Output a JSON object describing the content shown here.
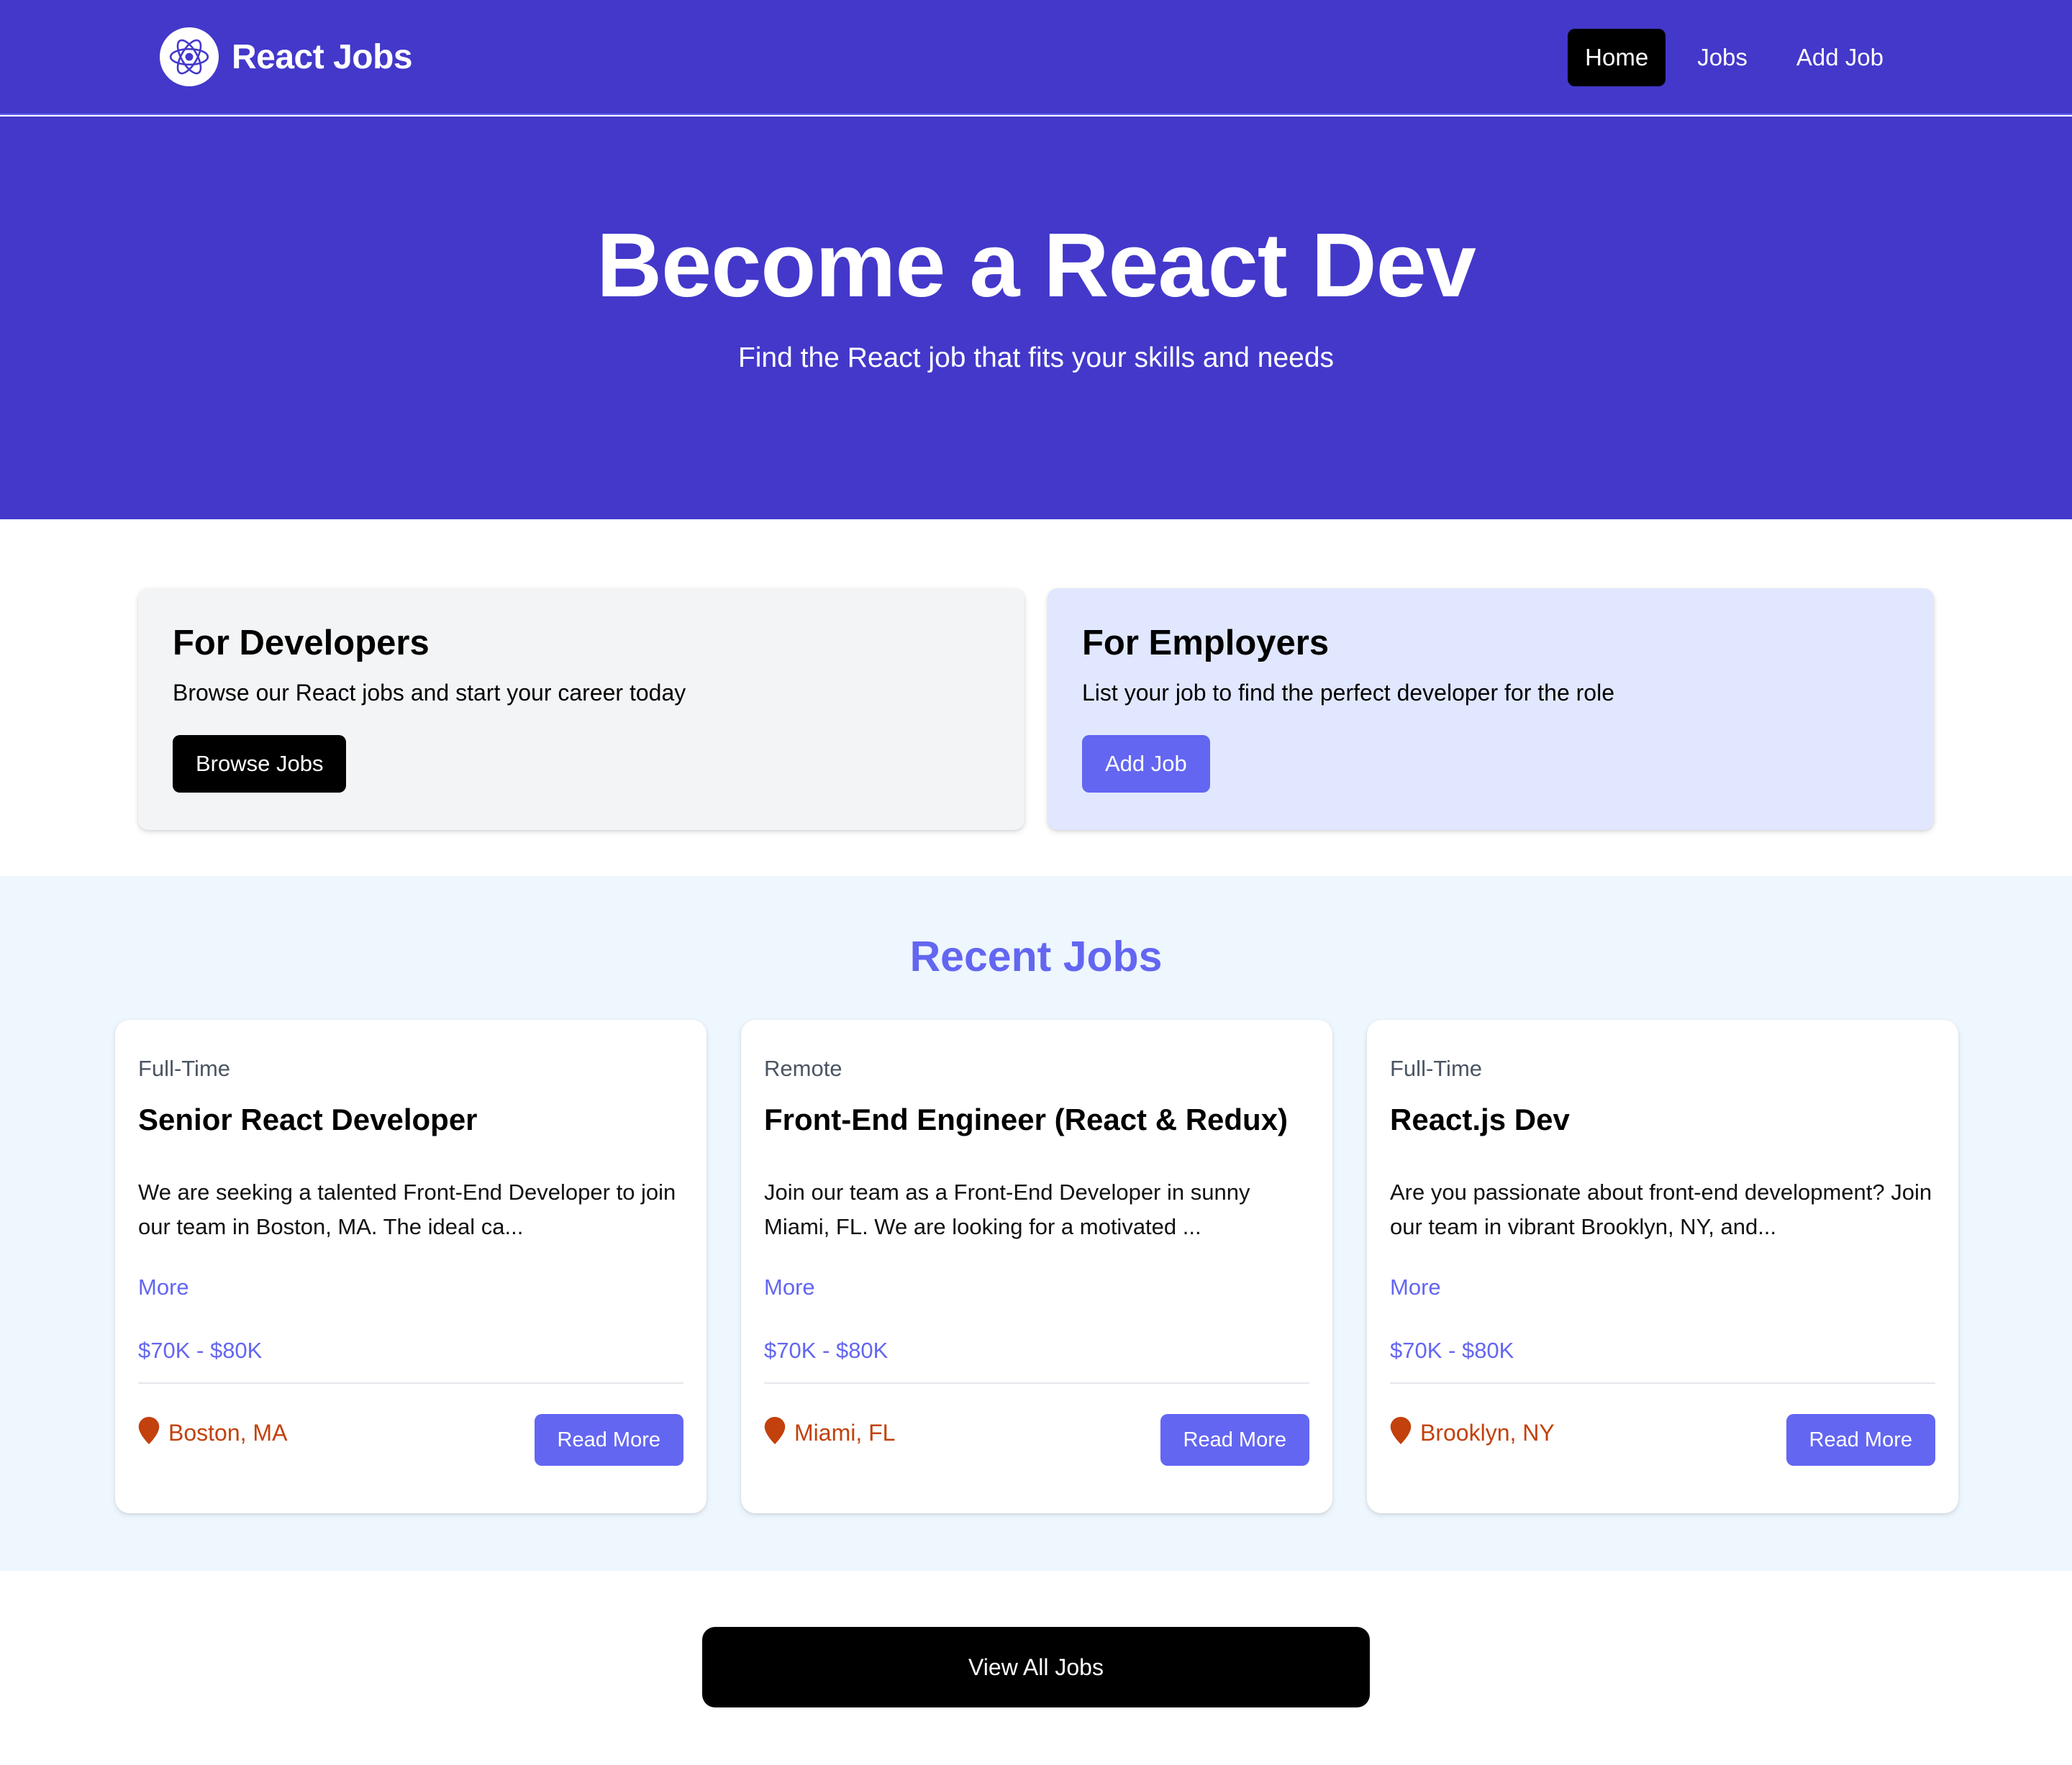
{
  "nav": {
    "brand": "React Jobs",
    "logo_icon": "react-atom-icon",
    "links": [
      {
        "label": "Home",
        "active": true
      },
      {
        "label": "Jobs",
        "active": false
      },
      {
        "label": "Add Job",
        "active": false
      }
    ]
  },
  "hero": {
    "title": "Become a React Dev",
    "subtitle": "Find the React job that fits your skills and needs"
  },
  "cta": {
    "developers": {
      "title": "For Developers",
      "text": "Browse our React jobs and start your career today",
      "button": "Browse Jobs"
    },
    "employers": {
      "title": "For Employers",
      "text": "List your job to find the perfect developer for the role",
      "button": "Add Job"
    }
  },
  "recent": {
    "title": "Recent Jobs",
    "jobs": [
      {
        "type": "Full-Time",
        "title": "Senior React Developer",
        "description": "We are seeking a talented Front-End Developer to join our team in Boston, MA. The ideal ca...",
        "more": "More",
        "salary": "$70K - $80K",
        "location": "Boston, MA",
        "button": "Read More"
      },
      {
        "type": "Remote",
        "title": "Front-End Engineer (React & Redux)",
        "description": "Join our team as a Front-End Developer in sunny Miami, FL. We are looking for a motivated ...",
        "more": "More",
        "salary": "$70K - $80K",
        "location": "Miami, FL",
        "button": "Read More"
      },
      {
        "type": "Full-Time",
        "title": "React.js Dev",
        "description": "Are you passionate about front-end development? Join our team in vibrant Brooklyn, NY, and...",
        "more": "More",
        "salary": "$70K - $80K",
        "location": "Brooklyn, NY",
        "button": "Read More"
      }
    ]
  },
  "view_all": "View All Jobs",
  "colors": {
    "primary": "#4338ca",
    "accent": "#6366f1",
    "location": "#c2410c",
    "recent_bg": "#eef6fe",
    "employer_card": "#e0e7ff",
    "developer_card": "#f3f4f6"
  }
}
